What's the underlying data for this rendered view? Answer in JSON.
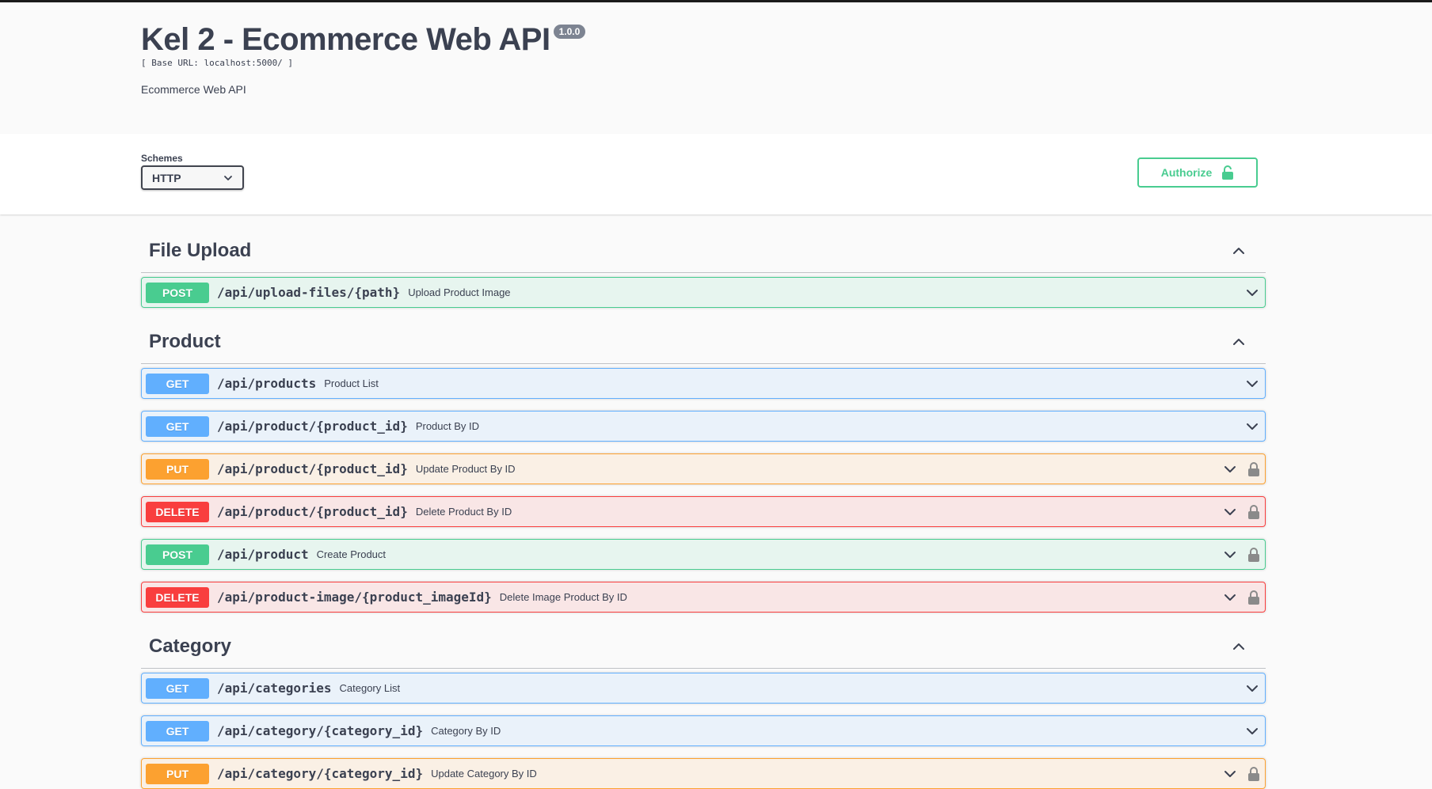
{
  "info": {
    "title": "Kel 2 - Ecommerce Web API",
    "version": "1.0.0",
    "base_url": "[ Base URL: localhost:5000/ ]",
    "description": "Ecommerce Web API"
  },
  "schemes": {
    "label": "Schemes",
    "selected": "HTTP"
  },
  "authorize": {
    "label": "Authorize"
  },
  "tags": [
    {
      "name": "File Upload",
      "operations": [
        {
          "method": "POST",
          "path": "/api/upload-files/{path}",
          "summary": "Upload Product Image",
          "locked": false
        }
      ]
    },
    {
      "name": "Product",
      "operations": [
        {
          "method": "GET",
          "path": "/api/products",
          "summary": "Product List",
          "locked": false
        },
        {
          "method": "GET",
          "path": "/api/product/{product_id}",
          "summary": "Product By ID",
          "locked": false
        },
        {
          "method": "PUT",
          "path": "/api/product/{product_id}",
          "summary": "Update Product By ID",
          "locked": true
        },
        {
          "method": "DELETE",
          "path": "/api/product/{product_id}",
          "summary": "Delete Product By ID",
          "locked": true
        },
        {
          "method": "POST",
          "path": "/api/product",
          "summary": "Create Product",
          "locked": true
        },
        {
          "method": "DELETE",
          "path": "/api/product-image/{product_imageId}",
          "summary": "Delete Image Product By ID",
          "locked": true
        }
      ]
    },
    {
      "name": "Category",
      "operations": [
        {
          "method": "GET",
          "path": "/api/categories",
          "summary": "Category List",
          "locked": false
        },
        {
          "method": "GET",
          "path": "/api/category/{category_id}",
          "summary": "Category By ID",
          "locked": false
        },
        {
          "method": "PUT",
          "path": "/api/category/{category_id}",
          "summary": "Update Category By ID",
          "locked": true
        }
      ]
    }
  ],
  "colors": {
    "post": "#49cc90",
    "get": "#61affe",
    "put": "#fca130",
    "delete": "#f93e3e",
    "text": "#3b4151"
  },
  "icons": {
    "expand": "chevron-down-icon",
    "collapse": "chevron-up-icon",
    "lock": "lock-icon",
    "select": "chevron-down-icon"
  }
}
